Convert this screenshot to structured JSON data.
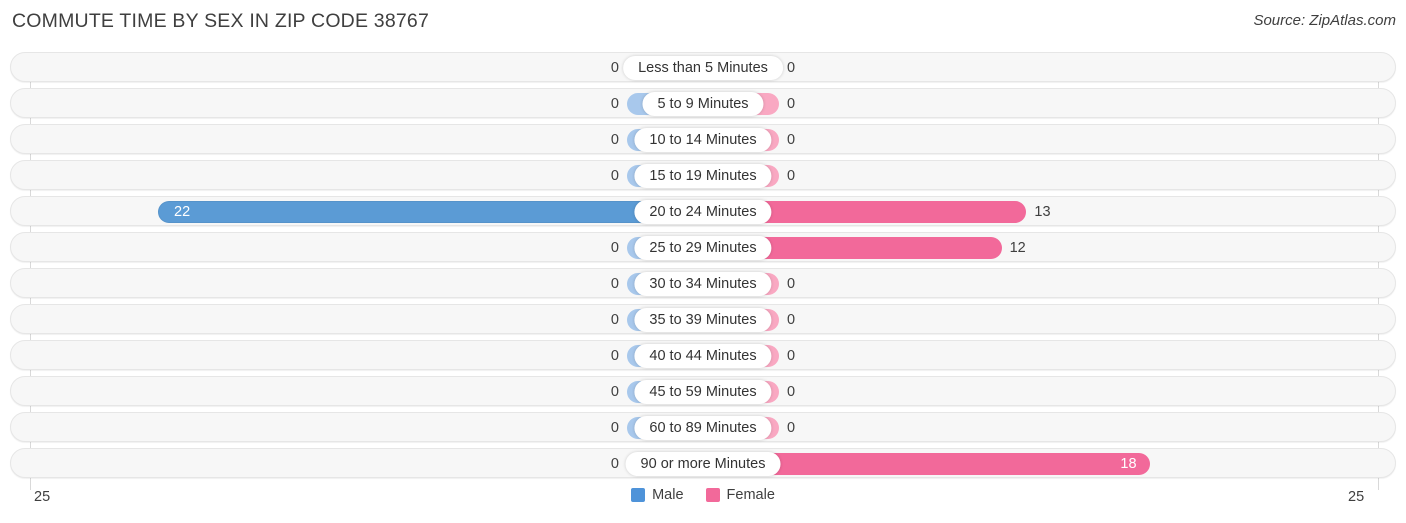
{
  "header": {
    "title": "COMMUTE TIME BY SEX IN ZIP CODE 38767",
    "source": "Source: ZipAtlas.com"
  },
  "legend": {
    "male_label": "Male",
    "female_label": "Female",
    "male_color": "#4e93d9",
    "female_color": "#f2699a"
  },
  "axis": {
    "left_max": "25",
    "right_max": "25"
  },
  "chart_data": {
    "type": "bar",
    "title": "COMMUTE TIME BY SEX IN ZIP CODE 38767",
    "subtitle": "Source: ZipAtlas.com",
    "orientation": "horizontal-diverging",
    "xlabel": "",
    "ylabel": "",
    "xlim": [
      25,
      25
    ],
    "grid": true,
    "legend_position": "bottom-center",
    "categories": [
      "Less than 5 Minutes",
      "5 to 9 Minutes",
      "10 to 14 Minutes",
      "15 to 19 Minutes",
      "20 to 24 Minutes",
      "25 to 29 Minutes",
      "30 to 34 Minutes",
      "35 to 39 Minutes",
      "40 to 44 Minutes",
      "45 to 59 Minutes",
      "60 to 89 Minutes",
      "90 or more Minutes"
    ],
    "series": [
      {
        "name": "Male",
        "color": "#5b9bd5",
        "values": [
          0,
          0,
          0,
          0,
          22,
          0,
          0,
          0,
          0,
          0,
          0,
          0
        ]
      },
      {
        "name": "Female",
        "color": "#f2699a",
        "values": [
          0,
          0,
          0,
          0,
          13,
          12,
          0,
          0,
          0,
          0,
          0,
          18
        ]
      }
    ],
    "rows": [
      {
        "label": "Less than 5 Minutes",
        "male": "0",
        "female": "0",
        "male_value": 0,
        "female_value": 0
      },
      {
        "label": "5 to 9 Minutes",
        "male": "0",
        "female": "0",
        "male_value": 0,
        "female_value": 0
      },
      {
        "label": "10 to 14 Minutes",
        "male": "0",
        "female": "0",
        "male_value": 0,
        "female_value": 0
      },
      {
        "label": "15 to 19 Minutes",
        "male": "0",
        "female": "0",
        "male_value": 0,
        "female_value": 0
      },
      {
        "label": "20 to 24 Minutes",
        "male": "22",
        "female": "13",
        "male_value": 22,
        "female_value": 13
      },
      {
        "label": "25 to 29 Minutes",
        "male": "0",
        "female": "12",
        "male_value": 0,
        "female_value": 12
      },
      {
        "label": "30 to 34 Minutes",
        "male": "0",
        "female": "0",
        "male_value": 0,
        "female_value": 0
      },
      {
        "label": "35 to 39 Minutes",
        "male": "0",
        "female": "0",
        "male_value": 0,
        "female_value": 0
      },
      {
        "label": "40 to 44 Minutes",
        "male": "0",
        "female": "0",
        "male_value": 0,
        "female_value": 0
      },
      {
        "label": "45 to 59 Minutes",
        "male": "0",
        "female": "0",
        "male_value": 0,
        "female_value": 0
      },
      {
        "label": "60 to 89 Minutes",
        "male": "0",
        "female": "0",
        "male_value": 0,
        "female_value": 0
      },
      {
        "label": "90 or more Minutes",
        "male": "0",
        "female": "18",
        "male_value": 0,
        "female_value": 18
      }
    ]
  }
}
